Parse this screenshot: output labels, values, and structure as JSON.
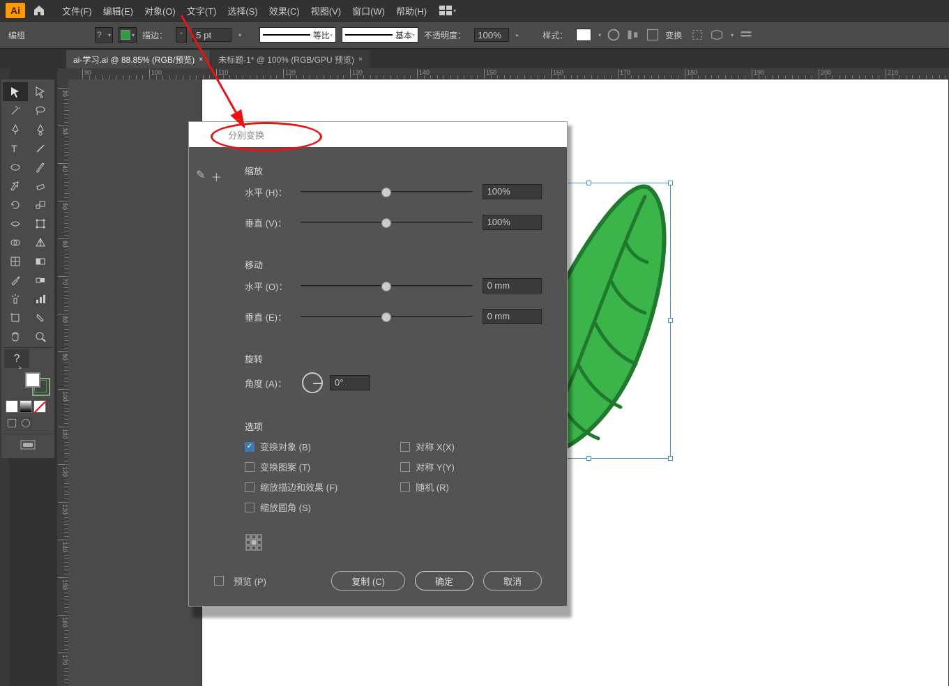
{
  "app": {
    "name": "Ai",
    "edit_mode": "编组"
  },
  "menu": {
    "file": "文件(F)",
    "edit": "编辑(E)",
    "object": "对象(O)",
    "type": "文字(T)",
    "select": "选择(S)",
    "effect": "效果(C)",
    "view": "视图(V)",
    "window": "窗口(W)",
    "help": "帮助(H)"
  },
  "controlbar": {
    "stroke_label": "描边：",
    "stroke_pt": "5 pt",
    "profile_uniform": "等比",
    "profile_basic": "基本",
    "opacity_label": "不透明度：",
    "opacity_val": "100%",
    "style_label": "样式：",
    "transform_label": "变换"
  },
  "tabs": [
    {
      "label": "ai-学习.ai @ 88.85% (RGB/预览)",
      "active": true
    },
    {
      "label": "未标题-1* @ 100% (RGB/GPU 预览)",
      "active": false
    }
  ],
  "ruler_h": [
    90,
    100,
    110,
    120,
    130,
    140,
    150,
    160,
    170,
    180,
    190,
    200,
    210
  ],
  "ruler_v": [
    20,
    30,
    40,
    50,
    60,
    70,
    80,
    90,
    100,
    110,
    120,
    130,
    140,
    150,
    160,
    170
  ],
  "dialog": {
    "title": "分别变换",
    "scale_section": "缩放",
    "scale_h_label": "水平 (H)：",
    "scale_h_val": "100%",
    "scale_v_label": "垂直 (V)：",
    "scale_v_val": "100%",
    "move_section": "移动",
    "move_h_label": "水平 (O)：",
    "move_h_val": "0 mm",
    "move_v_label": "垂直 (E)：",
    "move_v_val": "0 mm",
    "rotate_section": "旋转",
    "angle_label": "角度 (A)：",
    "angle_val": "0°",
    "options_section": "选项",
    "opt_transform_obj": "变换对象 (B)",
    "opt_transform_pattern": "变换图案 (T)",
    "opt_scale_strokes": "缩放描边和效果 (F)",
    "opt_scale_corners": "缩放圆角 (S)",
    "opt_reflect_x": "对称 X(X)",
    "opt_reflect_y": "对称 Y(Y)",
    "opt_random": "随机 (R)",
    "preview": "预览 (P)",
    "btn_copy": "复制 (C)",
    "btn_ok": "确定",
    "btn_cancel": "取消"
  },
  "icons": {
    "home": "⌂",
    "check": "✓",
    "close": "×",
    "pencil": "✎",
    "plus": "＋"
  }
}
